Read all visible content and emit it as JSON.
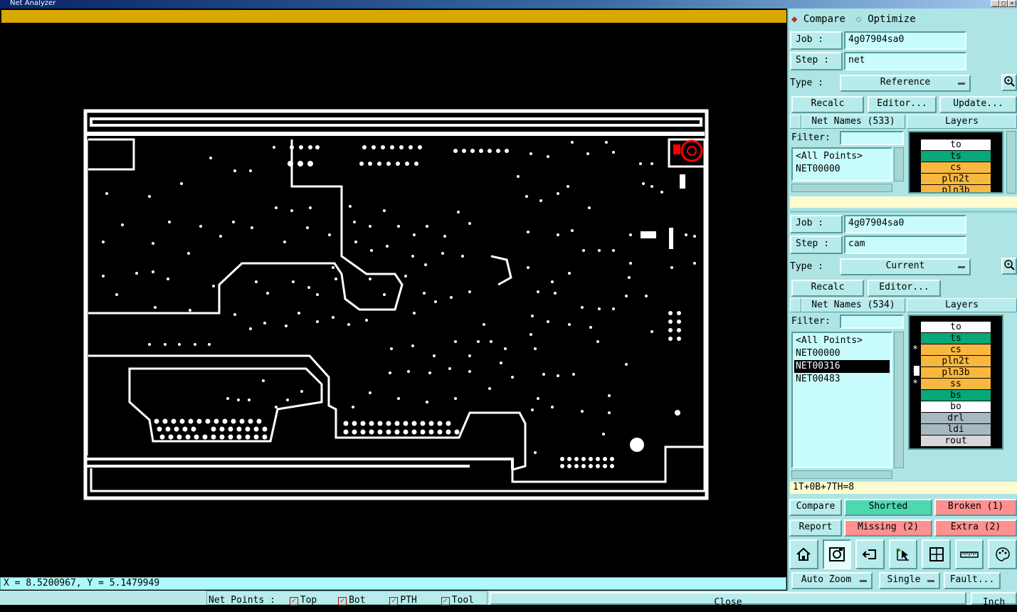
{
  "window": {
    "title": "Net Analyzer",
    "controls": [
      "_",
      "□",
      "×"
    ]
  },
  "status_bar": {
    "coords": "X = 8.5200967, Y = 5.1479949"
  },
  "mode": {
    "compare": "Compare",
    "optimize": "Optimize",
    "selected": "compare"
  },
  "reference": {
    "job_label": "Job  :",
    "job_value": "4g07904sa0",
    "step_label": "Step :",
    "step_value": "net",
    "type_label": "Type :",
    "type_value": "Reference",
    "recalc": "Recalc",
    "editor": "Editor...",
    "update": "Update...",
    "net_names": "Net Names (533)",
    "layers_title": "Layers",
    "filter_label": "Filter:",
    "nets": [
      "<All Points>",
      "NET00000"
    ],
    "layers": [
      {
        "name": "to",
        "color": "#ffffff",
        "star": false
      },
      {
        "name": "ts",
        "color": "#08a878",
        "star": false
      },
      {
        "name": "cs",
        "color": "#f8b840",
        "star": false
      },
      {
        "name": "pln2t",
        "color": "#f8b840",
        "star": false
      },
      {
        "name": "pln3b",
        "color": "#f8b840",
        "star": false
      }
    ]
  },
  "current": {
    "job_label": "Job  :",
    "job_value": "4g07904sa0",
    "step_label": "Step :",
    "step_value": "cam",
    "type_label": "Type :",
    "type_value": "Current",
    "recalc": "Recalc",
    "editor": "Editor...",
    "net_names": "Net Names (534)",
    "layers_title": "Layers",
    "filter_label": "Filter:",
    "nets": [
      "<All Points>",
      "NET00000",
      "NET00316",
      "NET00483"
    ],
    "selected_net": "NET00316",
    "layers": [
      {
        "name": "to",
        "color": "#ffffff",
        "star": false
      },
      {
        "name": "ts",
        "color": "#08a878",
        "star": false
      },
      {
        "name": "cs",
        "color": "#f8b840",
        "star": true
      },
      {
        "name": "pln2t",
        "color": "#f8b840",
        "star": false
      },
      {
        "name": "pln3b",
        "color": "#f8b840",
        "star": true
      },
      {
        "name": "ss",
        "color": "#f8b840",
        "star": true
      },
      {
        "name": "bs",
        "color": "#08a878",
        "star": false
      },
      {
        "name": "bo",
        "color": "#ffffff",
        "star": false
      },
      {
        "name": "drl",
        "color": "#a8b8c0",
        "star": false
      },
      {
        "name": "ldi",
        "color": "#a8b8c0",
        "star": false
      },
      {
        "name": "rout",
        "color": "#d8d8d8",
        "star": false
      }
    ],
    "info": "1T+0B+7TH=8"
  },
  "results": {
    "compare": "Compare",
    "shorted": "Shorted",
    "broken": "Broken (1)",
    "report": "Report",
    "missing": "Missing (2)",
    "extra": "Extra (2)"
  },
  "tools": [
    "home-icon",
    "snapshot-icon",
    "loop-back-icon",
    "select-net-icon",
    "window-frame-icon",
    "ruler-icon",
    "palette-icon"
  ],
  "bottom_controls": {
    "zoom": "Auto Zoom",
    "mode": "Single",
    "fault": "Fault..."
  },
  "footer": {
    "net_points_label": "Net Points :",
    "checks": [
      "Top",
      "Bot",
      "PTH",
      "Tool"
    ],
    "close": "Close",
    "units": "Inch"
  },
  "colors": {
    "banner": "#d9a900",
    "panel": "#aee4e4",
    "fault_marker": "#ff0000"
  }
}
